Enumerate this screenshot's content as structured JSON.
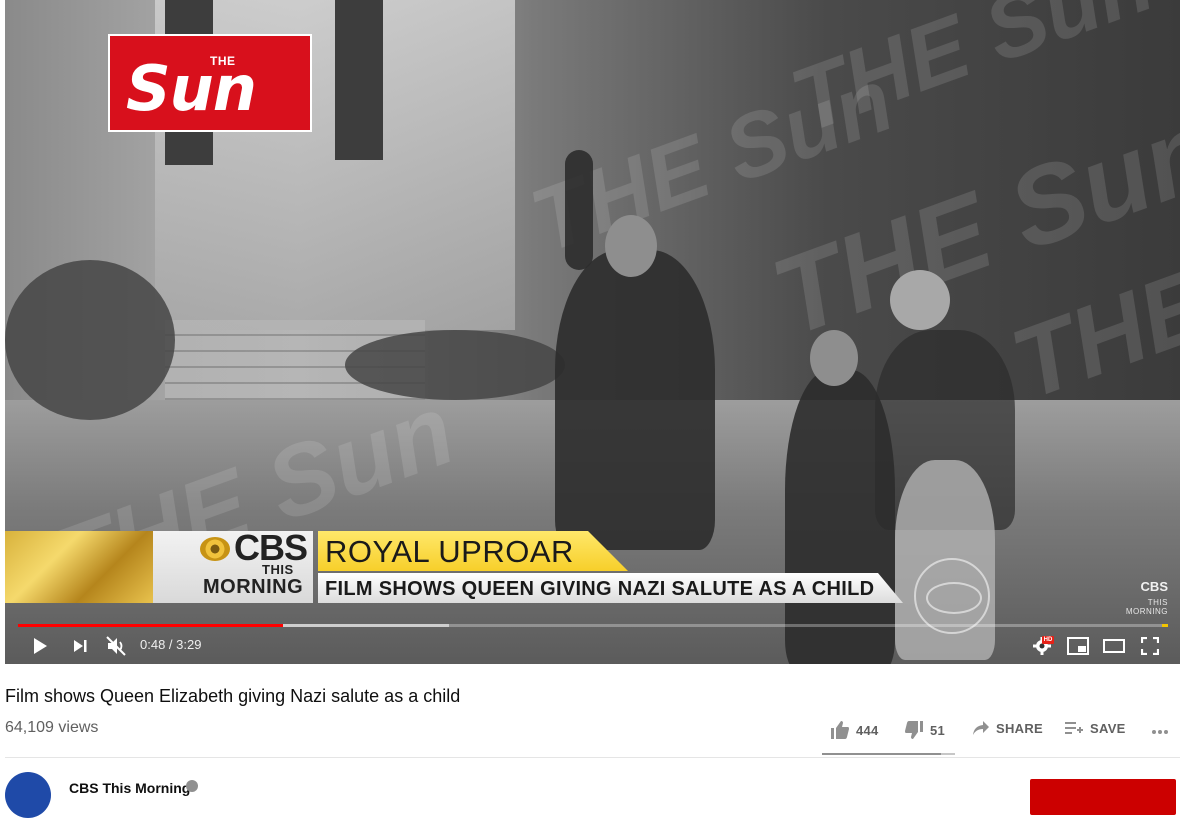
{
  "video": {
    "watermark_text": "THE Sun",
    "logo": {
      "small": "THE",
      "main": "Sun"
    },
    "lower_third": {
      "brand_top": "CBS",
      "brand_mid": "THIS",
      "brand_bottom": "MORNING",
      "headline": "ROYAL UPROAR",
      "subheadline": "FILM SHOWS QUEEN GIVING NAZI SALUTE AS A CHILD"
    },
    "corner_bug": {
      "top": "CBS",
      "sub": "THIS MORNING"
    }
  },
  "player": {
    "time_current": "0:48",
    "time_separator": " / ",
    "time_total": "3:29",
    "played_fraction": 0.23,
    "buffered_fraction": 0.375,
    "quality_badge": "HD",
    "colors": {
      "played": "#ff0000",
      "ad_marker": "#f2c500"
    }
  },
  "meta": {
    "title": "Film shows Queen Elizabeth giving Nazi salute as a child",
    "views": "64,109 views",
    "likes": "444",
    "dislikes": "51",
    "like_ratio": 0.897,
    "share_label": "SHARE",
    "save_label": "SAVE",
    "channel_name": "CBS This Morning"
  },
  "icons": {
    "play": "play-icon",
    "next": "next-icon",
    "mute": "muted-volume-icon",
    "settings": "gear-icon",
    "miniplayer": "miniplayer-icon",
    "theater": "theater-icon",
    "fullscreen": "fullscreen-icon",
    "like": "thumbs-up-icon",
    "dislike": "thumbs-down-icon",
    "share": "share-arrow-icon",
    "save": "playlist-add-icon",
    "more": "more-horizontal-icon"
  }
}
